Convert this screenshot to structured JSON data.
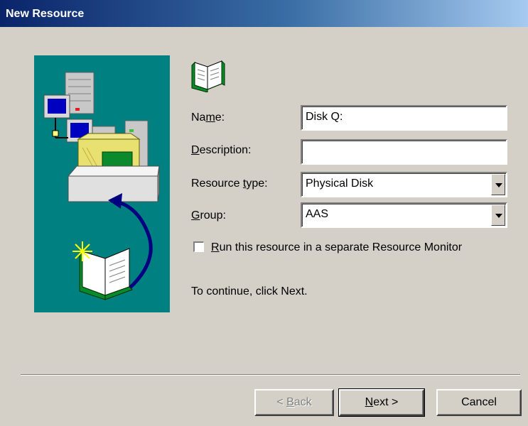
{
  "window": {
    "title": "New Resource"
  },
  "form": {
    "name": {
      "label_pre": "Na",
      "label_key": "m",
      "label_post": "e:",
      "value": "Disk Q:"
    },
    "description": {
      "label_pre": "",
      "label_key": "D",
      "label_post": "escription:",
      "value": ""
    },
    "resource_type": {
      "label_pre": "Resource ",
      "label_key": "t",
      "label_post": "ype:",
      "value": "Physical Disk"
    },
    "group": {
      "label_pre": "",
      "label_key": "G",
      "label_post": "roup:",
      "value": "AAS"
    },
    "separate_monitor": {
      "label_key": "R",
      "label_post": "un this resource in a separate Resource Monitor",
      "checked": false
    }
  },
  "hint": "To continue, click Next.",
  "buttons": {
    "back": {
      "pre": "< ",
      "key": "B",
      "post": "ack",
      "enabled": false
    },
    "next": {
      "pre": "",
      "key": "N",
      "post": "ext >"
    },
    "cancel": {
      "label": "Cancel"
    }
  },
  "icons": {
    "panel": [
      "server-icon",
      "computer-icon",
      "folder-tray-icon",
      "arrow-icon",
      "new-book-icon"
    ],
    "header": "book-icon"
  },
  "colors": {
    "panel_background": "#008080",
    "title_bar": "#0a246a",
    "dialog_face": "#d4d0c8"
  }
}
